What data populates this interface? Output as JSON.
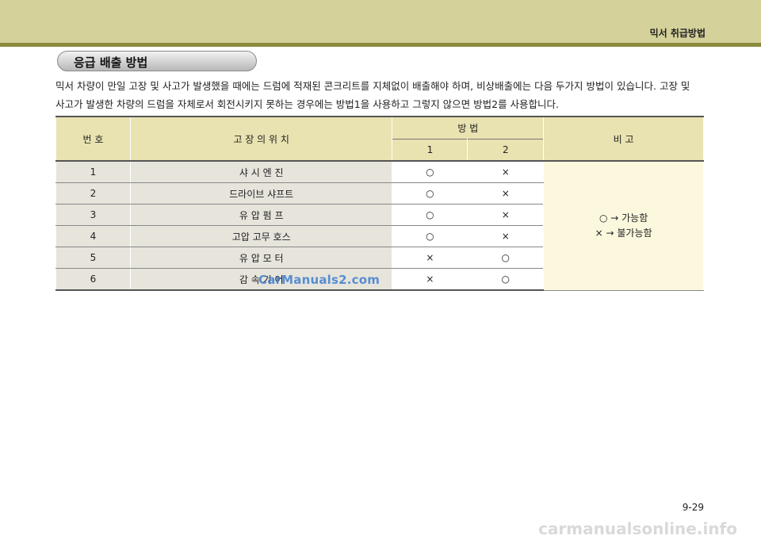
{
  "header": {
    "title": "믹서 취급방법"
  },
  "section": {
    "title": "응급 배출 방법"
  },
  "intro": {
    "line1": "믹서 차량이 만일 고장 및 사고가 발생했을 때에는 드럼에 적재된 콘크리트를 지체없이 배출해야 하며, 비상배출에는 다음 두가지 방법이 있습니다.  고장 및",
    "line2": "사고가 발생한 차량의 드럼을 자체로서 회전시키지 못하는 경우에는 방법1을 사용하고 그렇지 않으면 방법2를 사용합니다."
  },
  "table": {
    "headers": {
      "number": "번  호",
      "location": "고  장  의  위  치",
      "method": "방        법",
      "method1": "1",
      "method2": "2",
      "remarks": "비        고"
    },
    "rows": [
      {
        "no": "1",
        "location": "샤     시     엔     진",
        "m1": "○",
        "m2": "×"
      },
      {
        "no": "2",
        "location": "드라이브      샤프트",
        "m1": "○",
        "m2": "×"
      },
      {
        "no": "3",
        "location": "유     압     펌     프",
        "m1": "○",
        "m2": "×"
      },
      {
        "no": "4",
        "location": "고압     고무     호스",
        "m1": "○",
        "m2": "×"
      },
      {
        "no": "5",
        "location": "유     압     모     터",
        "m1": "×",
        "m2": "○"
      },
      {
        "no": "6",
        "location": "감     속     기     어",
        "m1": "×",
        "m2": "○"
      }
    ],
    "note_line1": "○ → 가능함",
    "note_line2": "× → 불가능함"
  },
  "footer": {
    "page": "9-29"
  },
  "watermarks": {
    "middle": "CarManuals2.com",
    "bottom": "carmanualsonline.info"
  }
}
